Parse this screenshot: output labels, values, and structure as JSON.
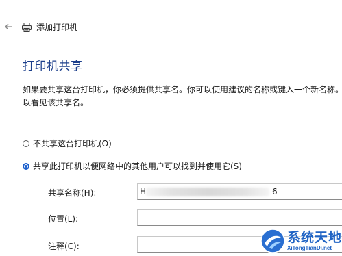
{
  "header": {
    "back_icon": "back-arrow-icon",
    "printer_icon": "printer-icon",
    "title": "添加打印机"
  },
  "section": {
    "heading": "打印机共享",
    "description_line1": "如果要共享这台打印机，你必须提供共享名。你可以使用建议的名称或键入一个新名称。",
    "description_line2": "以看见该共享名。"
  },
  "options": [
    {
      "label": "不共享这台打印机(O)",
      "checked": false
    },
    {
      "label": "共享此打印机以便网络中的其他用户可以找到并使用它(S)",
      "checked": true
    }
  ],
  "fields": {
    "share_name": {
      "label": "共享名称(H):",
      "value_start": "H",
      "value_end": "6"
    },
    "location": {
      "label": "位置(L):",
      "value": ""
    },
    "comment": {
      "label": "注释(C):",
      "value": ""
    }
  },
  "watermark": {
    "name": "系统天地",
    "url": "XiTongTianDi.net"
  },
  "colors": {
    "heading": "#1c3f8c",
    "accent": "#1c5fcc",
    "watermark": "#1f63c4"
  }
}
